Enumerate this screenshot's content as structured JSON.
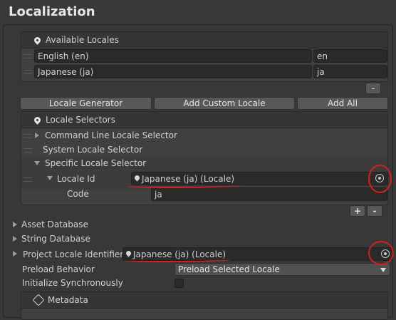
{
  "title": "Localization",
  "available_locales": {
    "header": "Available Locales",
    "rows": [
      {
        "name": "English (en)",
        "code": "en"
      },
      {
        "name": "Japanese (ja)",
        "code": "ja"
      }
    ],
    "remove_label": "-"
  },
  "buttons": {
    "locale_generator": "Locale Generator",
    "add_custom_locale": "Add Custom Locale",
    "add_all": "Add All"
  },
  "locale_selectors": {
    "header": "Locale Selectors",
    "items": [
      "Command Line Locale Selector",
      "System Locale Selector",
      "Specific Locale Selector"
    ],
    "locale_id_label": "Locale Id",
    "locale_id_value": "Japanese (ja) (Locale)",
    "code_label": "Code",
    "code_value": "ja",
    "add_label": "+",
    "remove_label": "-"
  },
  "settings": {
    "asset_database": "Asset Database",
    "string_database": "String Database",
    "project_locale_label": "Project Locale Identifier",
    "project_locale_value": "Japanese (ja) (Locale)",
    "preload_label": "Preload Behavior",
    "preload_value": "Preload Selected Locale",
    "init_sync_label": "Initialize Synchronously",
    "init_sync_checked": false
  },
  "metadata": {
    "header": "Metadata"
  },
  "icons": [
    "locale-pin-icon",
    "object-picker-icon",
    "dropdown-arrow-icon",
    "drag-handle-icon",
    "foldout-arrow-icon"
  ]
}
